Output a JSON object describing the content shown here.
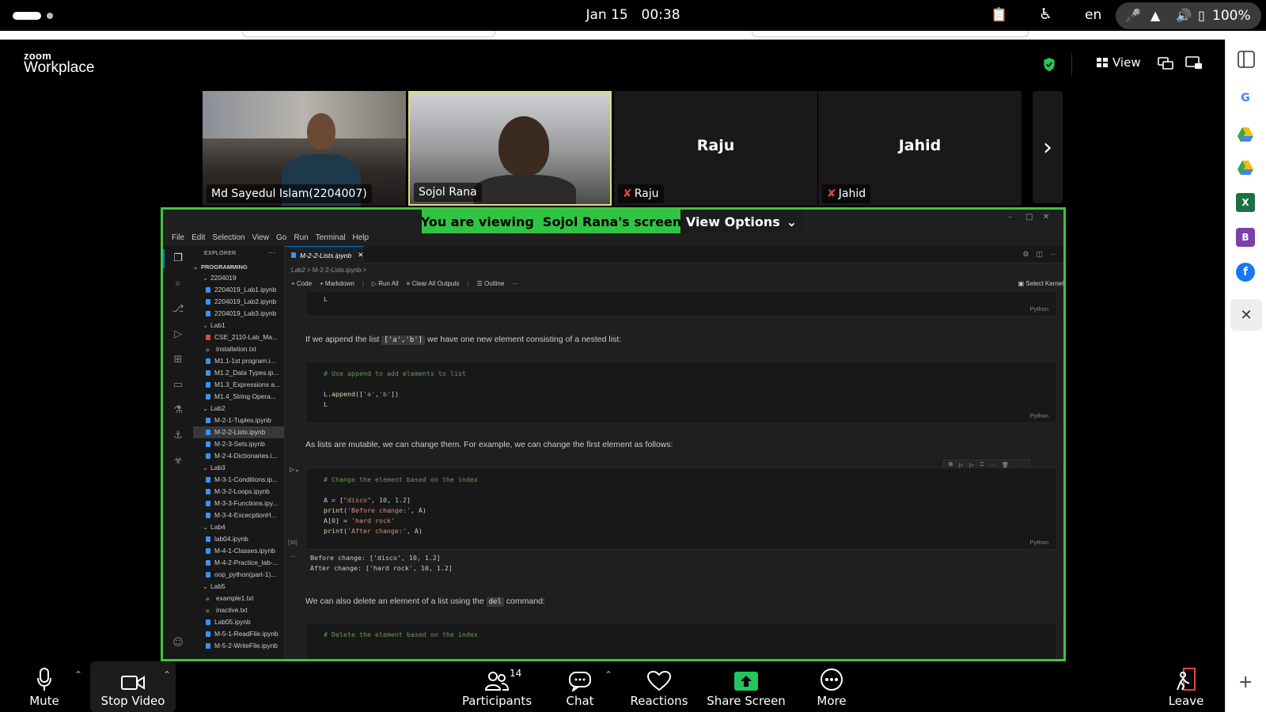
{
  "os": {
    "date": "Jan 15",
    "time": "00:38",
    "language": "en",
    "battery": "100%"
  },
  "zoom": {
    "brand_small": "zoom",
    "brand_big": "Workplace",
    "view_label": "View",
    "viewing_banner": "You are viewing  Sojol Rana's screen",
    "view_options": "View Options"
  },
  "participants": [
    {
      "name": "Md Sayedul Islam(2204007)",
      "video": true
    },
    {
      "name": "Sojol Rana",
      "video": true,
      "active_speaker": true
    },
    {
      "name": "Raju",
      "video": false,
      "muted": true
    },
    {
      "name": "Jahid",
      "video": false,
      "muted": true
    }
  ],
  "toolbar": {
    "mute": "Mute",
    "stop_video": "Stop Video",
    "participants": "Participants",
    "participants_count": "14",
    "chat": "Chat",
    "reactions": "Reactions",
    "share_screen": "Share Screen",
    "more": "More",
    "leave": "Leave"
  },
  "vscode": {
    "menu": [
      "File",
      "Edit",
      "Selection",
      "View",
      "Go",
      "Run",
      "Terminal",
      "Help"
    ],
    "explorer_title": "EXPLORER",
    "workspace": "PROGRAMMING",
    "tree": [
      {
        "label": "2204019",
        "type": "folder",
        "depth": 1
      },
      {
        "label": "2204019_Lab1.ipynb",
        "type": "nb",
        "depth": 2
      },
      {
        "label": "2204019_Lab2.ipynb",
        "type": "nb",
        "depth": 2
      },
      {
        "label": "2204019_Lab3.ipynb",
        "type": "nb",
        "depth": 2
      },
      {
        "label": "Lab1",
        "type": "folder",
        "depth": 1
      },
      {
        "label": "CSE_2110-Lab_Ma...",
        "type": "pdf",
        "depth": 2
      },
      {
        "label": "installation.txt",
        "type": "txt",
        "depth": 2
      },
      {
        "label": "M1.1-1st program.i...",
        "type": "nb",
        "depth": 2
      },
      {
        "label": "M1.2_Data Types.ip...",
        "type": "nb",
        "depth": 2
      },
      {
        "label": "M1.3_Expressions a...",
        "type": "nb",
        "depth": 2
      },
      {
        "label": "M1.4_String Opera...",
        "type": "nb",
        "depth": 2
      },
      {
        "label": "Lab2",
        "type": "folder",
        "depth": 1
      },
      {
        "label": "M-2-1-Tuples.ipynb",
        "type": "nb",
        "depth": 2
      },
      {
        "label": "M-2-2-Lists.ipynb",
        "type": "nb",
        "depth": 2,
        "selected": true
      },
      {
        "label": "M-2-3-Sets.ipynb",
        "type": "nb",
        "depth": 2
      },
      {
        "label": "M-2-4-Dictionaries.i...",
        "type": "nb",
        "depth": 2
      },
      {
        "label": "Lab3",
        "type": "folder",
        "depth": 1
      },
      {
        "label": "M-3-1-Conditions.ip...",
        "type": "nb",
        "depth": 2
      },
      {
        "label": "M-3-2-Loops.ipynb",
        "type": "nb",
        "depth": 2
      },
      {
        "label": "M-3-3-Functions.ipy...",
        "type": "nb",
        "depth": 2
      },
      {
        "label": "M-3-4-ExcecptionH...",
        "type": "nb",
        "depth": 2
      },
      {
        "label": "Lab4",
        "type": "folder",
        "depth": 1
      },
      {
        "label": "lab04.ipynb",
        "type": "nb",
        "depth": 2
      },
      {
        "label": "M-4-1-Classes.ipynb",
        "type": "nb",
        "depth": 2
      },
      {
        "label": "M-4-2-Practice_lab-...",
        "type": "nb",
        "depth": 2
      },
      {
        "label": "oop_python(part-1)...",
        "type": "nb",
        "depth": 2
      },
      {
        "label": "Lab5",
        "type": "folder",
        "depth": 1
      },
      {
        "label": "example1.txt",
        "type": "txt",
        "depth": 2
      },
      {
        "label": "inactive.txt",
        "type": "txt",
        "depth": 2
      },
      {
        "label": "Lab05.ipynb",
        "type": "nb",
        "depth": 2
      },
      {
        "label": "M-5-1-ReadFile.ipynb",
        "type": "nb",
        "depth": 2
      },
      {
        "label": "M-5-2-WriteFile.ipynb",
        "type": "nb",
        "depth": 2
      }
    ],
    "tab": "M-2-2-Lists.ipynb",
    "breadcrumb": "Lab2 > M-2-2-Lists.ipynb >",
    "toolbar": [
      "+ Code",
      "+ Markdown",
      "Run All",
      "Clear All Outputs",
      "Outline",
      "···"
    ],
    "kernel": "Select Kernel",
    "lang": "Python",
    "md1_pre": "If we append the list ",
    "md1_code": "['a','b']",
    "md1_post": " we have one new element consisting of a nested list:",
    "cell2_comment": "# Use append to add elements to list",
    "md2": "As lists are mutable, we can change them. For example, we can change the first element as follows:",
    "cell3_comment": "# Change the element based on the index",
    "exec_count": "[36]",
    "out1": "Before change: ['disco', 10, 1.2]",
    "out2": "After change: ['hard rock', 10, 1.2]",
    "md3_pre": "We can also delete an element of a list using the ",
    "md3_code": "del",
    "md3_post": " command:",
    "cell4_comment": "# Delete the element based on the index"
  }
}
